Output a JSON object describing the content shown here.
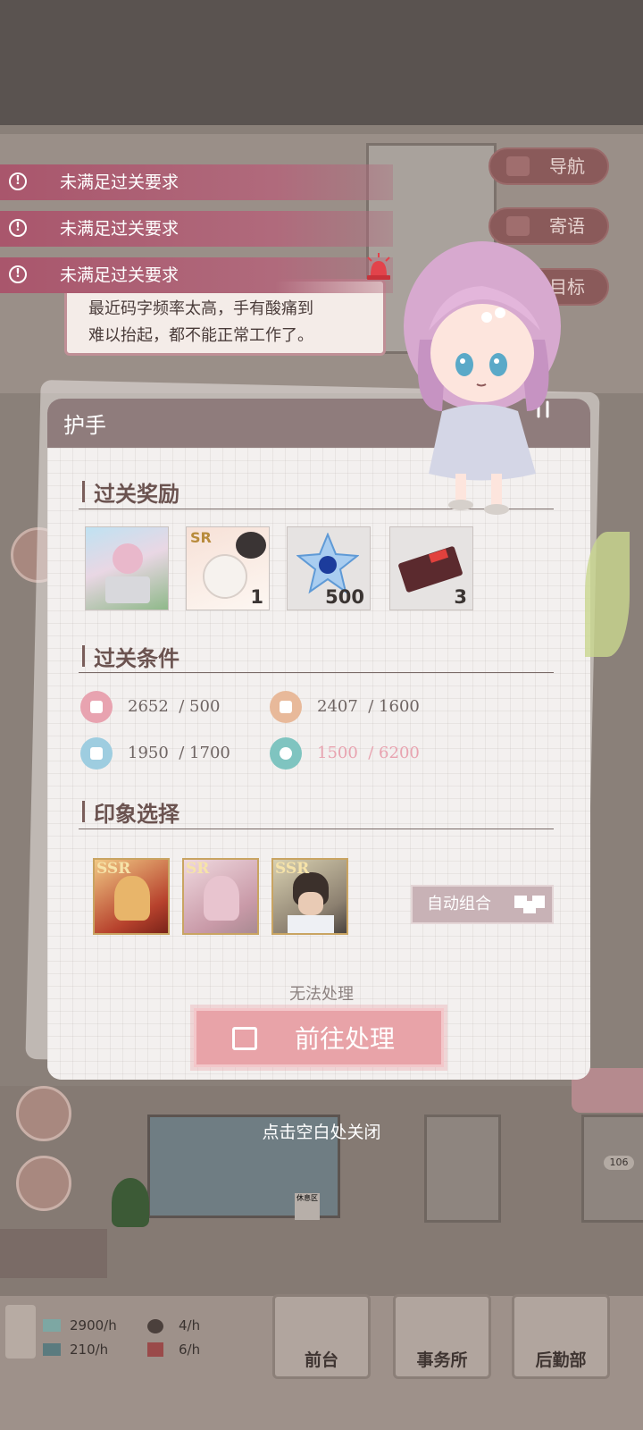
{
  "nav": {
    "guide": "导航",
    "message": "寄语",
    "goal": "目标"
  },
  "toasts": [
    "未满足过关要求",
    "未满足过关要求",
    "未满足过关要求"
  ],
  "dialog": {
    "line1": "最近码字频率太高，手有酸痛到",
    "line2": "难以抬起，都不能正常工作了。"
  },
  "panel": {
    "title": "护手",
    "rewards_title": "过关奖励",
    "rewards": [
      {
        "name": "card-reward",
        "count": ""
      },
      {
        "name": "sr-cat-card",
        "badge": "SR",
        "count": "1"
      },
      {
        "name": "blue-gem",
        "count": "500"
      },
      {
        "name": "red-ticket",
        "count": "3"
      }
    ],
    "conditions_title": "过关条件",
    "conditions": [
      {
        "icon": "fitness-icon",
        "color": "#e8a3b0",
        "value": "2652",
        "target": "/ 500",
        "met": true
      },
      {
        "icon": "person-icon",
        "color": "#e8b99a",
        "value": "2407",
        "target": "/ 1600",
        "met": true
      },
      {
        "icon": "education-icon",
        "color": "#9ecde0",
        "value": "1950",
        "target": "/ 1700",
        "met": true
      },
      {
        "icon": "flower-icon",
        "color": "#7fc4c0",
        "value": "1500",
        "target": "/ 6200",
        "met": false
      }
    ],
    "impression_title": "印象选择",
    "cards": [
      {
        "rarity": "SSR"
      },
      {
        "rarity": "SR"
      },
      {
        "rarity": "SSR"
      }
    ],
    "auto_button": "自动组合",
    "status": "无法处理",
    "go_button": "前往处理"
  },
  "close_hint": "点击空白处关闭",
  "room_number": "106",
  "sign_text": "休息区",
  "resources": [
    {
      "icon": "money-icon",
      "value": "2900/h"
    },
    {
      "icon": "fans-icon",
      "value": "4/h"
    },
    {
      "icon": "book-icon",
      "value": "210/h"
    },
    {
      "icon": "gift-icon",
      "value": "6/h"
    }
  ],
  "tabs": [
    "前台",
    "事务所",
    "后勤部"
  ],
  "colors": {
    "accent": "#e8a3a8",
    "unmet": "#e8a3b0",
    "toast": "#a9566c"
  }
}
